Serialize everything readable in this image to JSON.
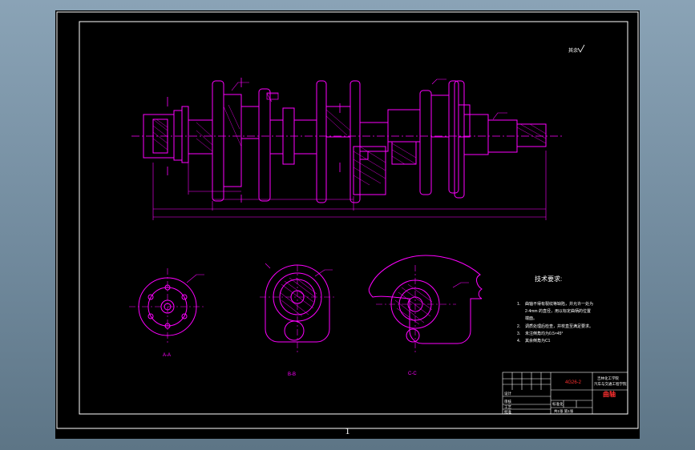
{
  "page_number": "1",
  "roughness_note": "其余",
  "section_labels": {
    "a": "A-A",
    "b": "B-B",
    "c": "C-C"
  },
  "tech_req": {
    "title": "技术要求:",
    "items": [
      {
        "num": "1.",
        "text": "曲轴不得有裂纹等缺陷，并允许一处为"
      },
      {
        "num": "",
        "text": "2-4mm 的直径，用以标定曲柄的位置"
      },
      {
        "num": "",
        "text": "端面。"
      },
      {
        "num": "2.",
        "text": "调质处理后检查，并校直至满足要求。"
      },
      {
        "num": "3.",
        "text": "未注倒角均为0.5×45°"
      },
      {
        "num": "4.",
        "text": "其余倒角为C1"
      }
    ]
  },
  "title_block": {
    "drawing_no": "4G26-2",
    "part_name": "曲轴",
    "org": "吉林化工学院",
    "org2": "汽车与交通工程学院",
    "scale_row": "共1张 第1张",
    "labels": [
      "设计",
      "审核",
      "工艺",
      "标准化",
      "批准"
    ]
  },
  "colors": {
    "line": "#ff00ff",
    "frame": "#ffffff",
    "title": "#ff3030"
  }
}
